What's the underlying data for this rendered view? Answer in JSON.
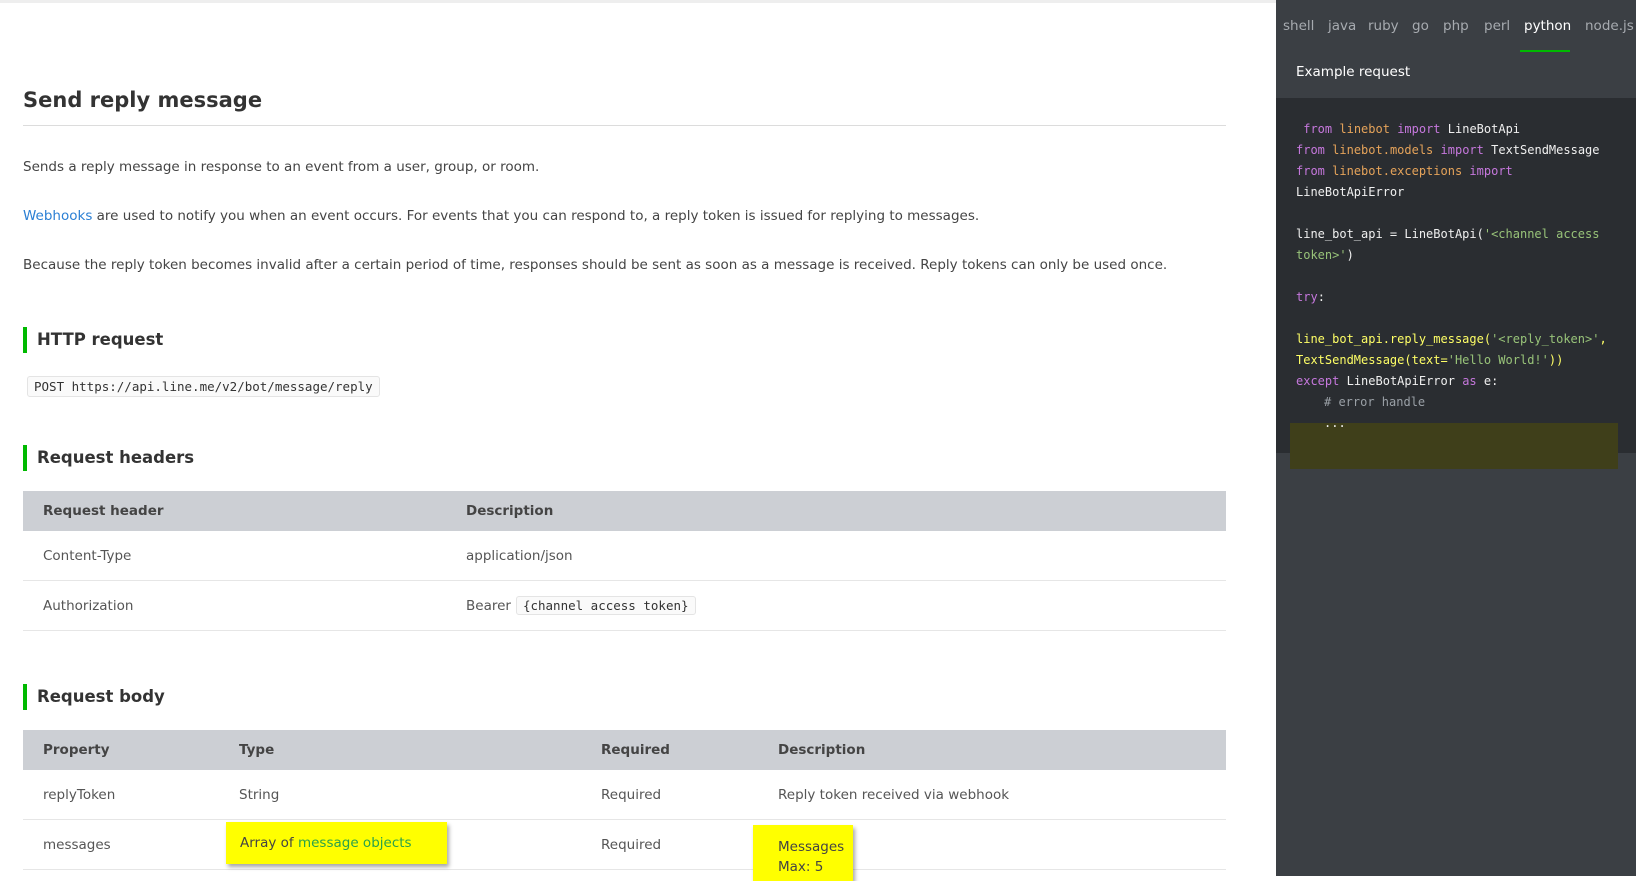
{
  "page": {
    "title": "Send reply message",
    "para1": "Sends a reply message in response to an event from a user, group, or room.",
    "para2_link": "Webhooks",
    "para2_rest": " are used to notify you when an event occurs. For events that you can respond to, a reply token is issued for replying to messages.",
    "para3": "Because the reply token becomes invalid after a certain period of time, responses should be sent as soon as a message is received. Reply tokens can only be used once."
  },
  "http_request": {
    "heading": "HTTP request",
    "endpoint": "POST https://api.line.me/v2/bot/message/reply"
  },
  "request_headers": {
    "heading": "Request headers",
    "columns": [
      "Request header",
      "Description"
    ],
    "rows": [
      {
        "header": "Content-Type",
        "description": "application/json"
      },
      {
        "header": "Authorization",
        "prefix": "Bearer",
        "code": "{channel access token}"
      }
    ]
  },
  "request_body": {
    "heading": "Request body",
    "columns": [
      "Property",
      "Type",
      "Required",
      "Description"
    ],
    "rows": [
      {
        "property": "replyToken",
        "type": "String",
        "required": "Required",
        "description": "Reply token received via webhook"
      },
      {
        "property": "messages",
        "type_prefix": "Array of",
        "type_link": "message objects",
        "required": "Required",
        "description_line1": "Messages",
        "description_line2": "Max: 5"
      }
    ]
  },
  "sidebar": {
    "tabs": [
      "shell",
      "java",
      "ruby",
      "go",
      "php",
      "perl",
      "python",
      "node.js"
    ],
    "active_tab": "python",
    "example_label": "Example request",
    "code": {
      "l1a": "from",
      "l1b": "linebot",
      "l1c": "import",
      "l1d": "LineBotApi",
      "l2a": "from",
      "l2b": "linebot.models",
      "l2c": "import",
      "l2d": "TextSendMessage",
      "l3a": "from",
      "l3b": "linebot.exceptions",
      "l3c": "import",
      "l4": "LineBotApiError",
      "l5a": "line_bot_api = LineBotApi(",
      "l5b": "'<channel access",
      "l6a": "token>'",
      "l6b": ")",
      "l7a": "try",
      "l7b": ":",
      "l8a": "line_bot_api.reply_message(",
      "l8b": "'<reply_token>'",
      "l8c": ",",
      "l9a": "TextSendMessage(text=",
      "l9b": "'Hello World!'",
      "l9c": "))",
      "l10a": "except",
      "l10b": "LineBotApiError",
      "l10c": "as",
      "l10d": "e:",
      "l11": "# error handle",
      "l12": "..."
    }
  },
  "colors": {
    "accent": "#00b900",
    "link": "#2a7fd4",
    "highlight": "#ffff00",
    "sidebar_bg": "#3b3f44",
    "code_bg": "#2a2d31"
  }
}
